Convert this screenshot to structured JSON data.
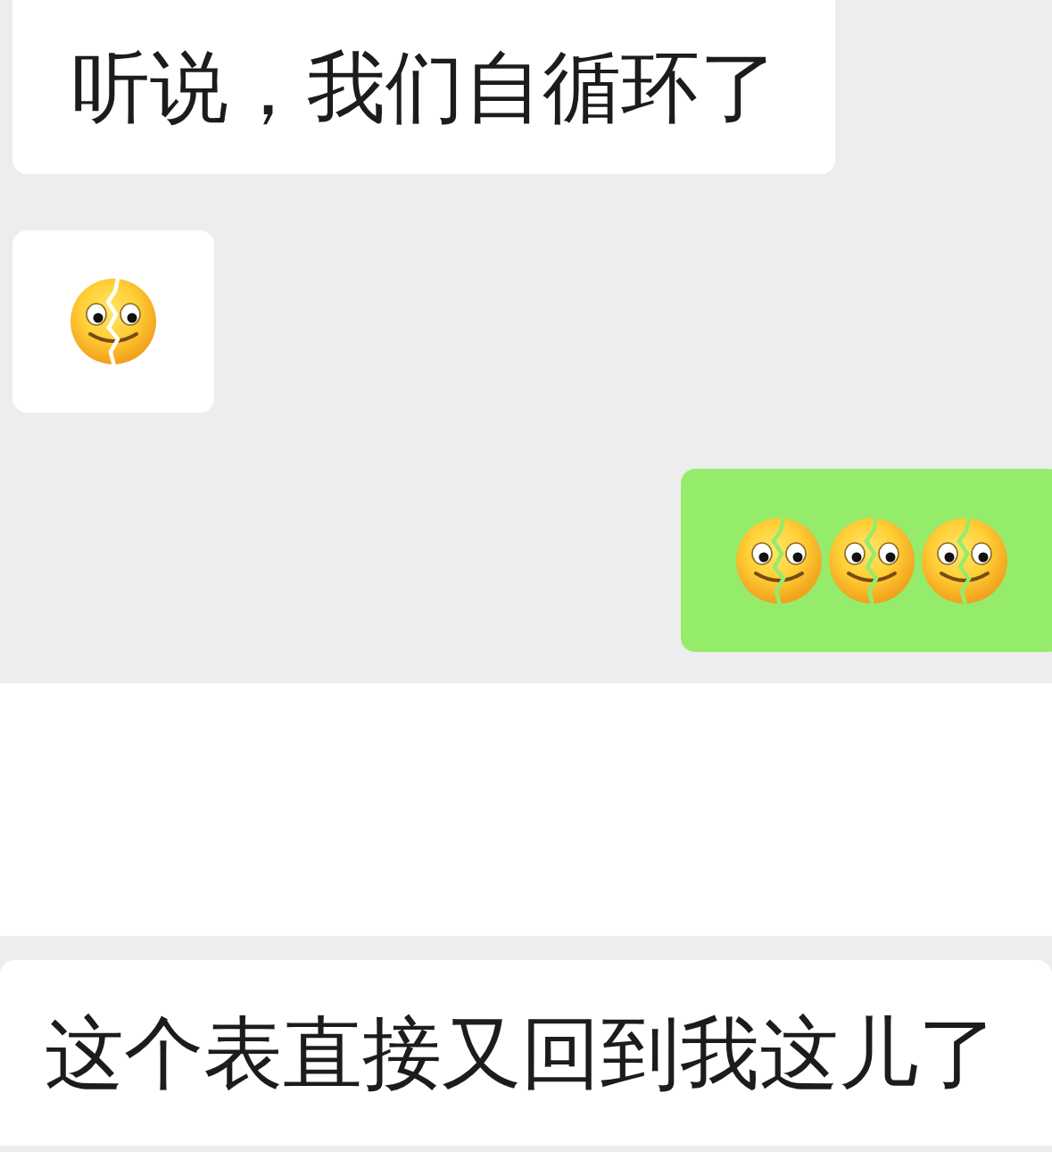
{
  "chat": {
    "messages": [
      {
        "outgoing": false,
        "kind": "text",
        "text": "听说，我们自循环了"
      },
      {
        "outgoing": false,
        "kind": "emoji",
        "emojis": [
          {
            "kind": "cracked-smile"
          }
        ]
      },
      {
        "outgoing": true,
        "kind": "emoji",
        "emojis": [
          {
            "kind": "cracked-smile"
          },
          {
            "kind": "cracked-smile"
          },
          {
            "kind": "cracked-smile"
          }
        ]
      }
    ]
  },
  "bottom_message": {
    "text": "这个表直接又回到我这儿了"
  }
}
